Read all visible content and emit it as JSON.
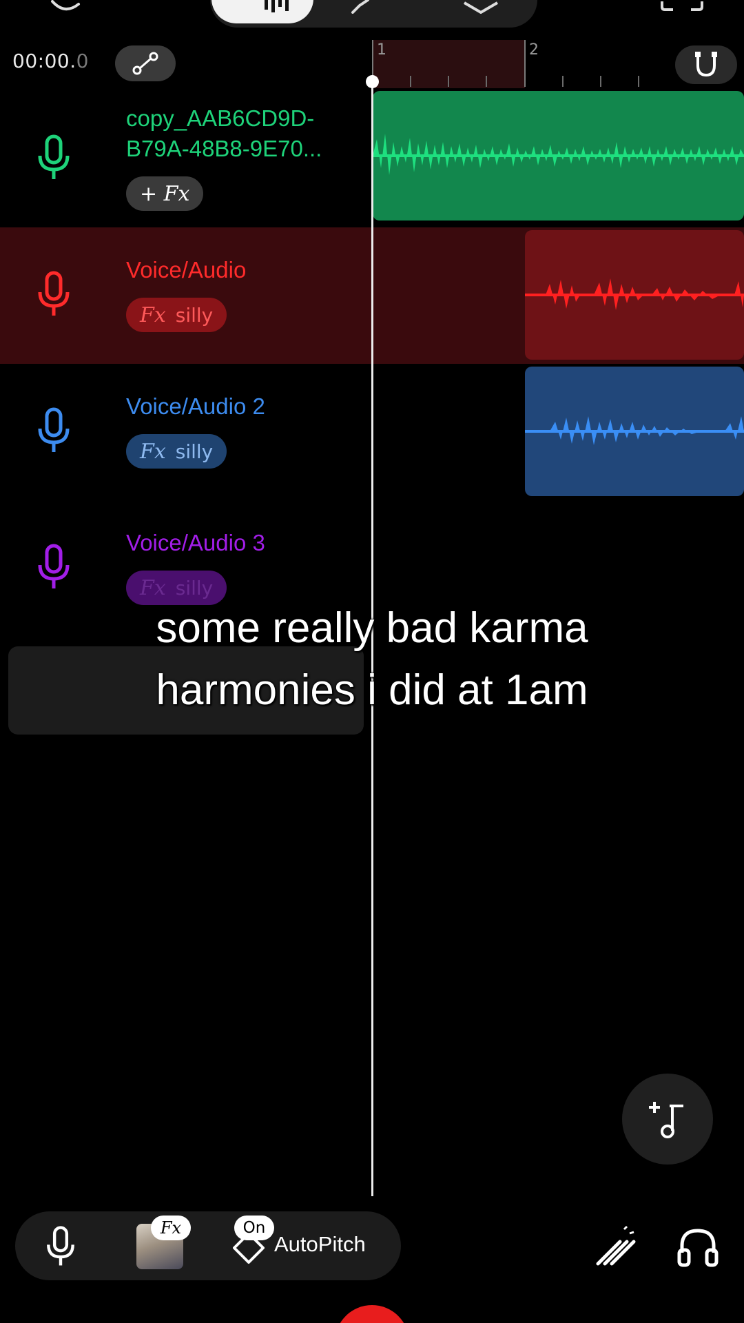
{
  "header": {
    "time_main": "00:00.",
    "time_fraction": "0",
    "ruler_marks": [
      "1",
      "2"
    ]
  },
  "tracks": [
    {
      "name_line1": "copy_AAB6CD9D-",
      "name_line2": "B79A-48B8-9E70...",
      "fx_label": "+ Fx",
      "preset": "",
      "color": "#1ed37a",
      "clip_color": "#12874d",
      "selected": false
    },
    {
      "name_line1": "Voice/Audio",
      "name_line2": "",
      "fx_label": "Fx",
      "preset": "silly",
      "color": "#ff2b2b",
      "clip_color": "#6e1216",
      "selected": true
    },
    {
      "name_line1": "Voice/Audio 2",
      "name_line2": "",
      "fx_label": "Fx",
      "preset": "silly",
      "color": "#3d8cf0",
      "clip_color": "#21477a",
      "selected": false
    },
    {
      "name_line1": "Voice/Audio 3",
      "name_line2": "",
      "fx_label": "Fx",
      "preset": "silly",
      "color": "#a21ee8",
      "clip_color": "#4a0f6e",
      "selected": false
    }
  ],
  "caption": {
    "line1": "some really bad karma",
    "line2": "harmonies i did at 1am"
  },
  "bottom_bar": {
    "fx_badge": "Fx",
    "on_badge": "On",
    "autopitch_label": "AutoPitch"
  }
}
